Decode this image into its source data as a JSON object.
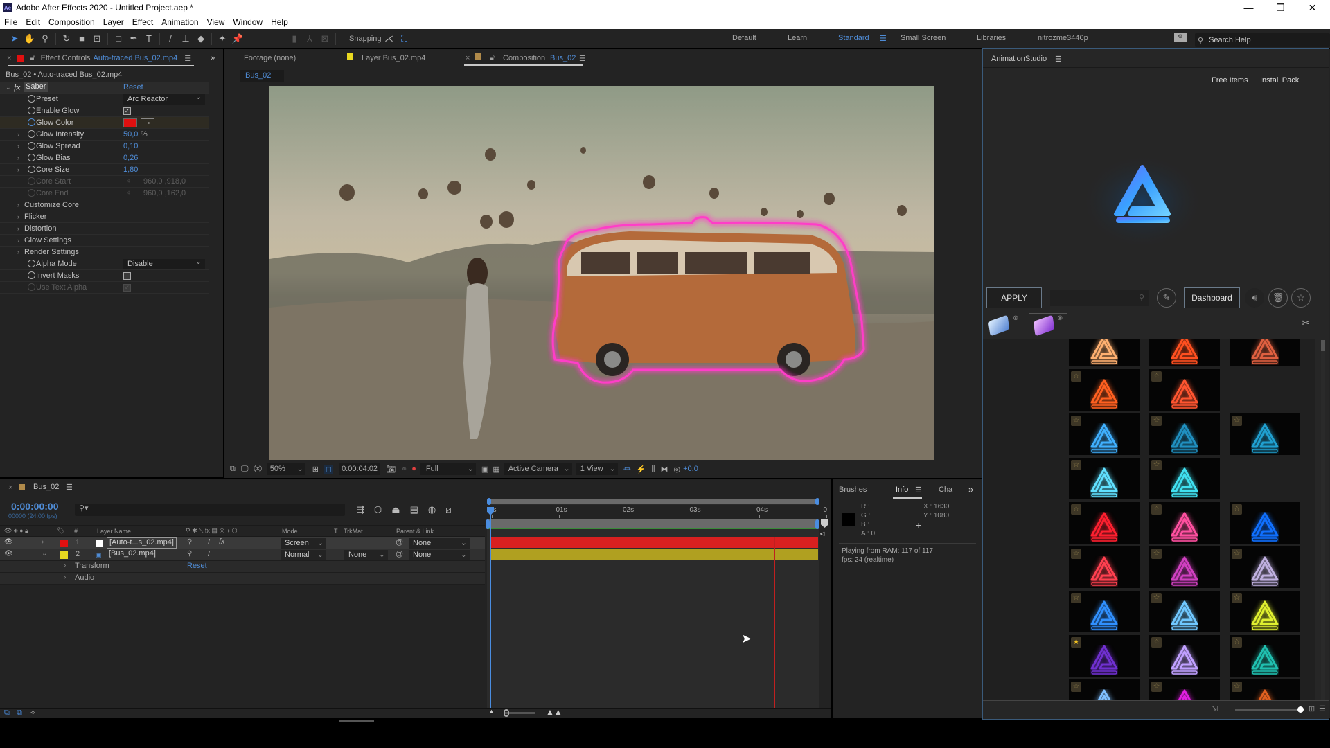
{
  "app": {
    "title": "Adobe After Effects 2020 - Untitled Project.aep *",
    "logo": "Ae",
    "window_controls": {
      "minimize": "—",
      "restore": "❐",
      "close": "✕"
    }
  },
  "menu": [
    "File",
    "Edit",
    "Composition",
    "Layer",
    "Effect",
    "Animation",
    "View",
    "Window",
    "Help"
  ],
  "toolbar": {
    "tools": [
      "selection-tool",
      "hand-tool",
      "zoom-tool",
      "rotate-tool",
      "camera-tool",
      "pan-behind-tool",
      "rectangle-tool",
      "pen-tool",
      "type-tool",
      "brush-tool",
      "clone-stamp-tool",
      "eraser-tool",
      "roto-brush-tool",
      "puppet-pin-tool"
    ],
    "snapping_label": "Snapping",
    "snapping_checked": false,
    "workspaces": [
      "Default",
      "Learn",
      "Standard",
      "Small Screen",
      "Libraries",
      "nitrozme3440p"
    ],
    "active_workspace": "Standard",
    "search_placeholder": "Search Help"
  },
  "effect_controls": {
    "tab_label": "Effect Controls",
    "tab_file": "Auto-traced Bus_02.mp4",
    "header": "Bus_02 • Auto-traced Bus_02.mp4",
    "effect_name": "Saber",
    "reset_label": "Reset",
    "properties": [
      {
        "label": "Preset",
        "type": "dropdown",
        "value": "Arc Reactor"
      },
      {
        "label": "Enable Glow",
        "type": "checkbox",
        "checked": true
      },
      {
        "label": "Glow Color",
        "type": "color",
        "value": "#e01010"
      },
      {
        "label": "Glow Intensity",
        "type": "number",
        "value": "50,0",
        "unit": "%"
      },
      {
        "label": "Glow Spread",
        "type": "number",
        "value": "0,10"
      },
      {
        "label": "Glow Bias",
        "type": "number",
        "value": "0,26"
      },
      {
        "label": "Core Size",
        "type": "number",
        "value": "1,80"
      },
      {
        "label": "Core Start",
        "type": "point",
        "value": "960,0 ,918,0",
        "disabled": true
      },
      {
        "label": "Core End",
        "type": "point",
        "value": "960,0 ,162,0",
        "disabled": true
      }
    ],
    "groups": [
      "Customize Core",
      "Flicker",
      "Distortion",
      "Glow Settings",
      "Render Settings"
    ],
    "extra_properties": [
      {
        "label": "Alpha Mode",
        "type": "dropdown",
        "value": "Disable"
      },
      {
        "label": "Invert Masks",
        "type": "checkbox",
        "checked": false
      },
      {
        "label": "Use Text Alpha",
        "type": "checkbox",
        "checked": true,
        "disabled": true
      }
    ]
  },
  "viewer": {
    "tabs": [
      {
        "label": "Footage (none)"
      },
      {
        "label": "Layer Bus_02.mp4",
        "color": "#e8d820"
      },
      {
        "label": "Composition",
        "name": "Bus_02",
        "color": "#b08a4a",
        "active": true
      }
    ],
    "comp_breadcrumb": "Bus_02",
    "zoom": "50%",
    "timecode": "0:00:04:02",
    "resolution": "Full",
    "camera": "Active Camera",
    "views": "1 View",
    "exposure": "+0,0"
  },
  "timeline": {
    "comp_name": "Bus_02",
    "current_time": "0:00:00:00",
    "frame_info": "00000 (24.00 fps)",
    "search_placeholder": "",
    "columns": [
      "#",
      "Layer Name",
      "Mode",
      "T",
      "TrkMat",
      "Parent & Link"
    ],
    "layers": [
      {
        "index": "1",
        "name": "[Auto-t...s_02.mp4]",
        "label_color": "#e01010",
        "mode": "Screen",
        "trkmat": "",
        "parent": "None",
        "bar_color": "#d82020"
      },
      {
        "index": "2",
        "name": "[Bus_02.mp4]",
        "label_color": "#e8d820",
        "mode": "Normal",
        "trkmat": "None",
        "parent": "None",
        "bar_color": "#b0a020",
        "expanded": true
      }
    ],
    "sublayers": [
      {
        "label": "Transform",
        "reset": "Reset"
      },
      {
        "label": "Audio"
      }
    ],
    "ruler": [
      "0s",
      "01s",
      "02s",
      "03s",
      "04s",
      "0"
    ]
  },
  "info_panel": {
    "tabs": [
      "Brushes",
      "Info",
      "Cha"
    ],
    "active_tab": "Info",
    "r": "R :",
    "g": "G :",
    "b": "B :",
    "a": "A :  0",
    "x": "X : 1630",
    "y": "Y : 1080",
    "status1": "Playing from RAM: 117 of 117",
    "status2": "fps: 24 (realtime)"
  },
  "animation_studio": {
    "title": "AnimationStudio",
    "links": [
      "Free Items",
      "Install Pack"
    ],
    "apply_label": "APPLY",
    "dashboard_label": "Dashboard",
    "search_placeholder": "",
    "thumbnails": [
      {
        "color": "#ffb070",
        "fav": false
      },
      {
        "color": "#ff5020",
        "fav": false
      },
      {
        "color": "#e06040",
        "fav": false
      },
      {
        "color": "#ff6020",
        "fav": false
      },
      {
        "color": "#ff5530",
        "fav": false
      },
      null,
      {
        "color": "#40b0ff",
        "fav": false
      },
      {
        "color": "#2090c0",
        "fav": false
      },
      {
        "color": "#20a0d0",
        "fav": false
      },
      {
        "color": "#60e0ff",
        "fav": false
      },
      {
        "color": "#40e0f0",
        "fav": false
      },
      null,
      {
        "color": "#ff2030",
        "fav": false
      },
      {
        "color": "#ff50a0",
        "fav": false
      },
      {
        "color": "#1070ff",
        "fav": false
      },
      {
        "color": "#ff4050",
        "fav": false
      },
      {
        "color": "#d040c0",
        "fav": false
      },
      {
        "color": "#c0b0e0",
        "fav": false
      },
      {
        "color": "#3090ff",
        "fav": false
      },
      {
        "color": "#70c8ff",
        "fav": false
      },
      {
        "color": "#e0f030",
        "fav": false
      },
      {
        "color": "#7030d0",
        "fav": true
      },
      {
        "color": "#c0a0ff",
        "fav": false
      },
      {
        "color": "#20c0b0",
        "fav": false
      },
      {
        "color": "#80c0ff",
        "fav": false
      },
      {
        "color": "#e020e0",
        "fav": false
      },
      {
        "color": "#e06020",
        "fav": false
      }
    ]
  }
}
